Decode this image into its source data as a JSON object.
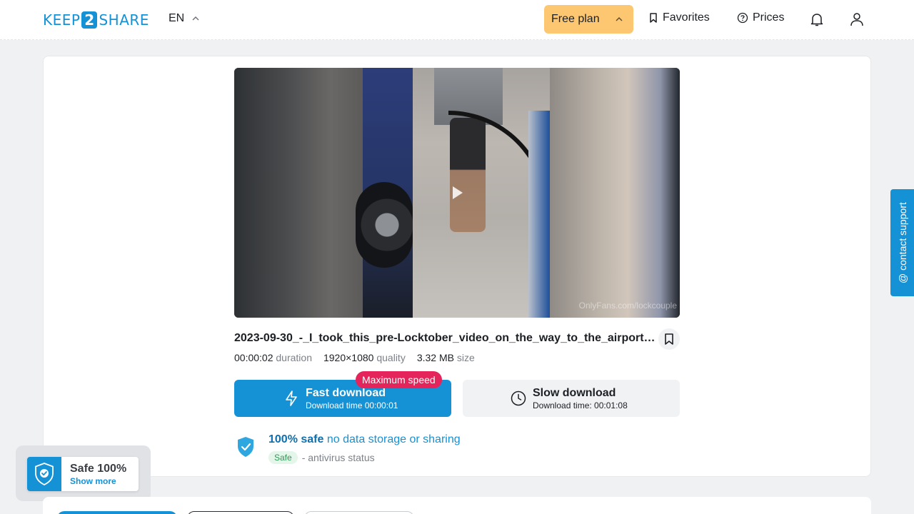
{
  "header": {
    "logo_left": "KEEP",
    "logo_num": "2",
    "logo_right": "SHARE",
    "language": "EN",
    "plan_label": "Free plan",
    "favorites_label": "Favorites",
    "prices_label": "Prices"
  },
  "video": {
    "watermark": "OnlyFans.com/lockcouple"
  },
  "file": {
    "title": "2023-09-30_-_I_took_this_pre-Locktober_video_on_the_way_to_the_airport_g...",
    "duration_value": "00:00:02",
    "duration_label": "duration",
    "quality_value": "1920×1080",
    "quality_label": "quality",
    "size_value": "3.32 MB",
    "size_label": "size"
  },
  "download": {
    "fast_label": "Fast download",
    "fast_time": "Download time 00:00:01",
    "max_badge": "Maximum speed",
    "slow_label": "Slow download",
    "slow_time": "Download time: 00:01:08"
  },
  "safety": {
    "headline": "100% safe",
    "headline_more": " no data storage or sharing",
    "pill": "Safe",
    "status": "- antivirus status"
  },
  "support": {
    "label": "@ contact support"
  },
  "widget": {
    "title": "Safe 100%",
    "link": "Show more"
  },
  "colors": {
    "accent": "#1591d6",
    "plan": "#fdc772",
    "badge": "#e4245a",
    "safe_pill_bg": "#e3f6e9"
  },
  "icons": [
    "chevron-up-icon",
    "bookmark-icon",
    "help-circle-icon",
    "bell-icon",
    "user-icon",
    "bolt-icon",
    "clock-icon",
    "shield-check-icon",
    "play-icon"
  ]
}
